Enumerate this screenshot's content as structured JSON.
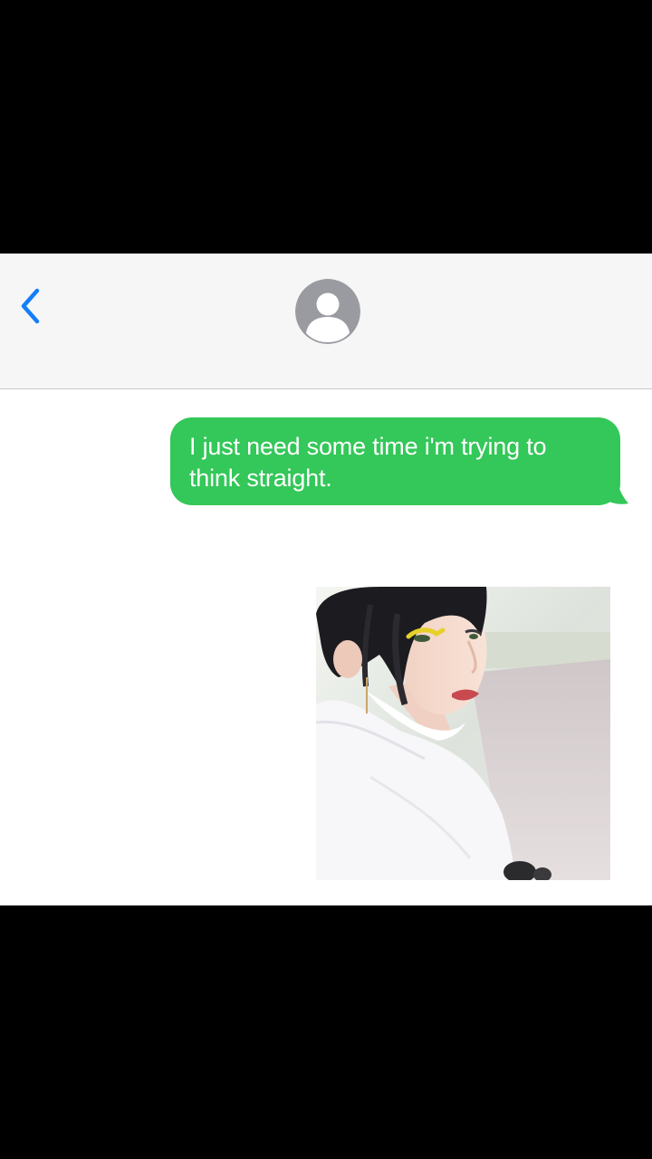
{
  "header": {
    "back_icon": "chevron-left-icon",
    "avatar_icon": "person-icon",
    "accent_color": "#147efb",
    "avatar_color": "#9a9ba1"
  },
  "messages": [
    {
      "type": "text",
      "direction": "sent",
      "text": "I just need some time i'm trying to think straight.",
      "bubble_color": "#34c759"
    },
    {
      "type": "image",
      "direction": "sent",
      "image_subject": "woman-portrait-photo"
    }
  ]
}
